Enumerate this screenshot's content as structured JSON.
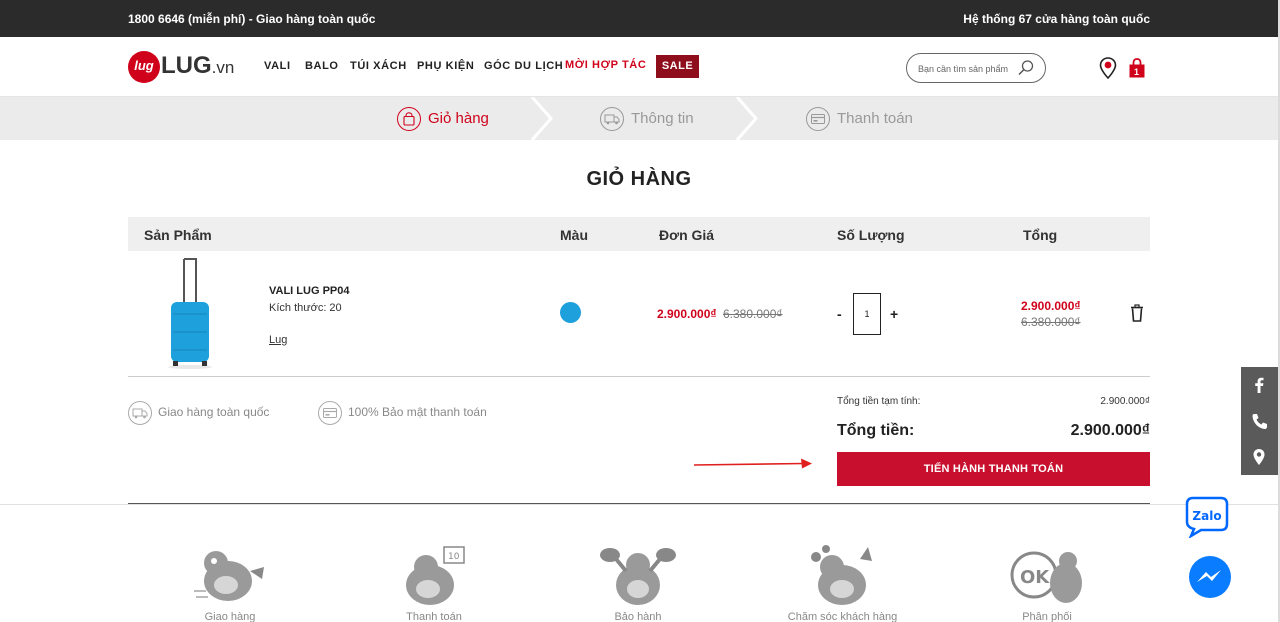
{
  "topbar": {
    "hotline": "1800 6646 (miễn phí) - Giao hàng toàn quốc",
    "stores": "Hệ thống 67 cửa hàng toàn quốc"
  },
  "header": {
    "logo_mark": "lug",
    "logo_word": "LUG",
    "logo_suffix": ".vn",
    "nav": [
      "VALI",
      "BALO",
      "TÚI XÁCH",
      "PHỤ KIỆN",
      "GÓC DU LỊCH",
      "MỜI HỢP TÁC",
      "SALE"
    ],
    "search_placeholder": "Bạn cần tìm sản phẩm",
    "cart_count": "1",
    "colors": {
      "brand_red": "#d0021b",
      "sale_bg": "#8f0e1c"
    }
  },
  "steps": [
    {
      "label": "Giỏ hàng",
      "icon": "bag-icon",
      "active": true
    },
    {
      "label": "Thông tin",
      "icon": "truck-icon",
      "active": false
    },
    {
      "label": "Thanh toán",
      "icon": "payment-icon",
      "active": false
    }
  ],
  "cart": {
    "title": "GIỎ HÀNG",
    "columns": [
      "Sản Phẩm",
      "Màu",
      "Đơn Giá",
      "Số Lượng",
      "Tổng"
    ],
    "items": [
      {
        "name": "VALI LUG PP04",
        "size": "Kích thước: 20",
        "brand": "Lug",
        "color": "#1ea0dc",
        "unit_price": "2.900.000₫",
        "unit_price_old": "6.380.000₫",
        "qty_minus": "-",
        "quantity": "1",
        "qty_plus": "+",
        "total": "2.900.000₫",
        "total_old": "6.380.000₫"
      }
    ]
  },
  "features": [
    "Giao hàng toàn quốc",
    "100% Bảo mật thanh toán"
  ],
  "summary": {
    "subtotal_label": "Tổng tiền tạm tính:",
    "subtotal_value": "2.900.000₫",
    "total_label": "Tổng tiền:",
    "total_value": "2.900.000₫",
    "checkout_label": "TIẾN HÀNH THANH TOÁN"
  },
  "services": [
    "Giao hàng",
    "Thanh toán",
    "Bảo hành",
    "Chăm sóc khách hàng",
    "Phân phối"
  ],
  "floating": {
    "zalo_label": "Zalo"
  }
}
